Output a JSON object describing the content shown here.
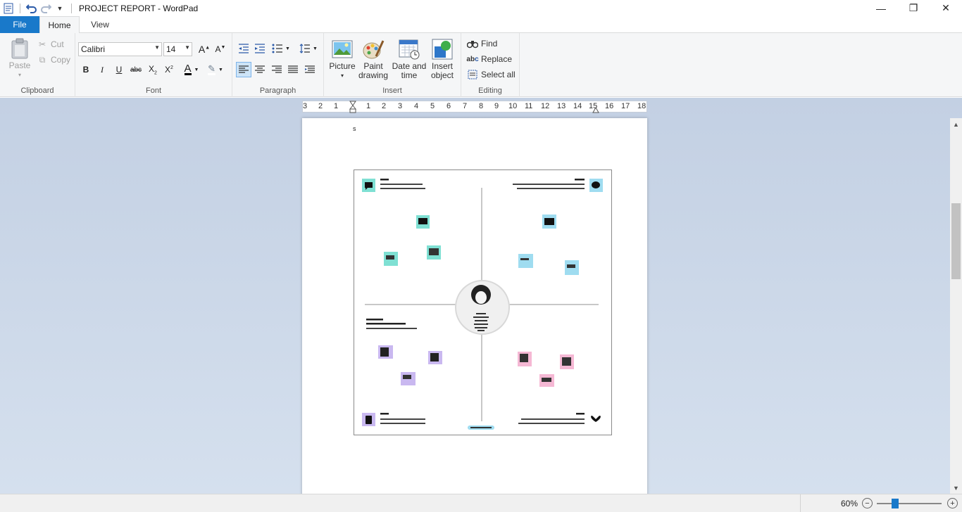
{
  "titlebar": {
    "title": "PROJECT REPORT - WordPad",
    "minimize": "—",
    "maximize": "❐",
    "close": "✕"
  },
  "tabs": {
    "file": "File",
    "home": "Home",
    "view": "View"
  },
  "ribbon": {
    "clipboard": {
      "label": "Clipboard",
      "paste": "Paste",
      "cut": "Cut",
      "copy": "Copy"
    },
    "font": {
      "label": "Font",
      "family": "Calibri",
      "size": "14"
    },
    "paragraph": {
      "label": "Paragraph"
    },
    "insert": {
      "label": "Insert",
      "picture": "Picture",
      "paint_1": "Paint",
      "paint_2": "drawing",
      "datetime_1": "Date and",
      "datetime_2": "time",
      "object_1": "Insert",
      "object_2": "object"
    },
    "editing": {
      "label": "Editing",
      "find": "Find",
      "replace": "Replace",
      "select_all": "Select all"
    }
  },
  "ruler": {
    "marks": [
      "3",
      "2",
      "1",
      "1",
      "2",
      "3",
      "4",
      "5",
      "6",
      "7",
      "8",
      "9",
      "10",
      "11",
      "12",
      "13",
      "14",
      "15",
      "16",
      "17",
      "18"
    ]
  },
  "document": {
    "text_char": "s"
  },
  "statusbar": {
    "zoom": "60%",
    "zoom_level": 0.6
  },
  "colors": {
    "accent": "#1979ca",
    "ribbon_bg": "#f5f6f7",
    "workspace_bg": "#c8d4e6",
    "teal_note": "#7fe0d3",
    "blue_note": "#9fdcf0",
    "purple_note": "#c9b8f0",
    "pink_note": "#f5b8d4"
  }
}
